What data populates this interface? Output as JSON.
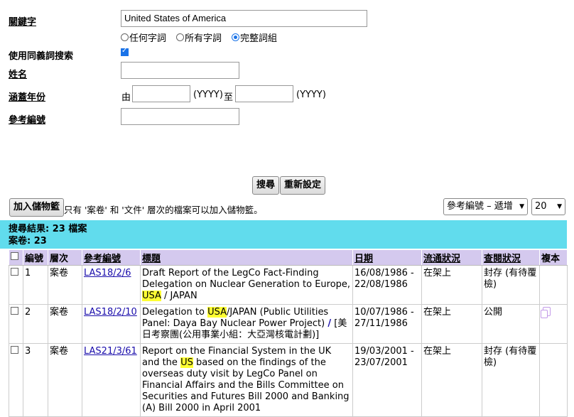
{
  "search_form": {
    "keyword_label": "關鍵字",
    "keyword_value": "United States of America",
    "match_options": [
      "任何字詞",
      "所有字詞",
      "完整詞組"
    ],
    "synonym_label": "使用同義詞搜索",
    "name_label": "姓名",
    "year_label": "涵蓋年份",
    "year_from": "由",
    "year_format_from": "(YYYY)",
    "year_to": "至",
    "year_format_to": "(YYYY)",
    "ref_label": "參考編號",
    "search_button": "搜尋",
    "reset_button": "重新設定"
  },
  "toolbar": {
    "add_button": "加入儲物籃",
    "note": "只有 '案卷' 和 '文件' 層次的檔案可以加入儲物籃。",
    "sort_value": "參考編號 – 遞增",
    "page_size": "20"
  },
  "summary": {
    "line1": "搜尋結果: 23 檔案",
    "line2": "案卷: 23"
  },
  "table": {
    "headers": [
      "",
      "編號",
      "層次",
      "參考編號",
      "標題",
      "日期",
      "流通狀況",
      "查閱狀況",
      "複本"
    ]
  },
  "rows": [
    {
      "no": "1",
      "level": "案卷",
      "ref": "LAS18/2/6",
      "title_a": "Draft Report of the LegCo Fact-Finding Delegation on Nuclear Generation to Europe, ",
      "title_hl": "USA",
      "title_b": " / JAPAN",
      "date": "16/08/1986 - 22/08/1986",
      "circulation": "在架上",
      "access": "封存 (有待覆檢)"
    },
    {
      "no": "2",
      "level": "案卷",
      "ref": "LAS18/2/10",
      "title_a": "Delegation to ",
      "title_hl": "USA",
      "title_b": "/JAPAN (Public Utilities Panel: Daya Bay Nuclear Power Project) ",
      "title_sep": "/",
      "title_c": " [美日考察團(公用事業小組：大亞灣核電計劃)]",
      "date": "10/07/1986 - 27/11/1986",
      "circulation": "在架上",
      "access": "公開"
    },
    {
      "no": "3",
      "level": "案卷",
      "ref": "LAS21/3/61",
      "title_a": "Report on the Financial System in the UK and the ",
      "title_hl": "US",
      "title_b": " based on the findings of the overseas duty visit by LegCo Panel on Financial Affairs and the Bills Committee on Securities and Futures Bill 2000 and Banking (A) Bill 2000 in April 2001",
      "date": "19/03/2001 - 23/07/2001",
      "circulation": "在架上",
      "access": "封存 (有待覆檢)"
    }
  ]
}
